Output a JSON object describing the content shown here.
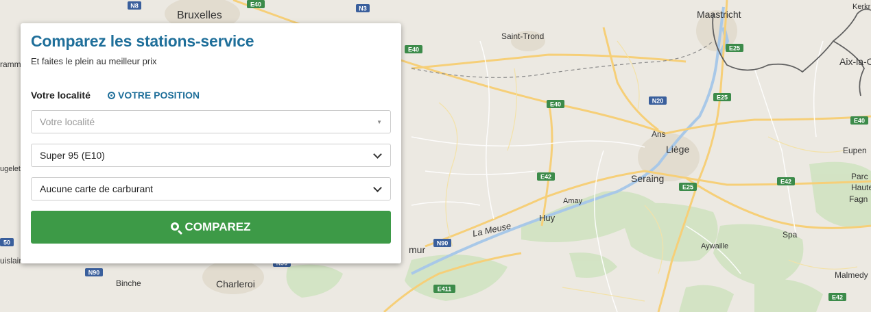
{
  "map": {
    "places": [
      {
        "name": "Bruxelles",
        "size": 16
      },
      {
        "name": "Maastricht",
        "size": 14
      },
      {
        "name": "Saint-Trond",
        "size": 12
      },
      {
        "name": "Kerkr",
        "size": 11
      },
      {
        "name": "Aix-la-C",
        "size": 14
      },
      {
        "name": "Ans",
        "size": 12
      },
      {
        "name": "Liège",
        "size": 14
      },
      {
        "name": "Eupen",
        "size": 12
      },
      {
        "name": "Seraing",
        "size": 14
      },
      {
        "name": "Amay",
        "size": 11
      },
      {
        "name": "Huy",
        "size": 13
      },
      {
        "name": "La Meuse",
        "size": 13
      },
      {
        "name": "Aywaille",
        "size": 11
      },
      {
        "name": "Spa",
        "size": 12
      },
      {
        "name": "Malmedy",
        "size": 12
      },
      {
        "name": "Binche",
        "size": 12
      },
      {
        "name": "Charleroi",
        "size": 14
      },
      {
        "name": "mur",
        "size": 14
      },
      {
        "name": "ramm",
        "size": 12
      },
      {
        "name": "ugelet",
        "size": 11
      },
      {
        "name": "uislair",
        "size": 12
      },
      {
        "name": "Parc",
        "size": 12
      },
      {
        "name": "Haute",
        "size": 12
      },
      {
        "name": "Fagn",
        "size": 12
      }
    ],
    "shields": [
      {
        "label": "E40",
        "color": "green"
      },
      {
        "label": "N3",
        "color": "blue"
      },
      {
        "label": "N8",
        "color": "blue"
      },
      {
        "label": "E40",
        "color": "green"
      },
      {
        "label": "E25",
        "color": "green"
      },
      {
        "label": "E40",
        "color": "green"
      },
      {
        "label": "N20",
        "color": "blue"
      },
      {
        "label": "E25",
        "color": "green"
      },
      {
        "label": "E40",
        "color": "green"
      },
      {
        "label": "E42",
        "color": "green"
      },
      {
        "label": "E25",
        "color": "green"
      },
      {
        "label": "E42",
        "color": "green"
      },
      {
        "label": "N90",
        "color": "blue"
      },
      {
        "label": "N90",
        "color": "blue"
      },
      {
        "label": "N90",
        "color": "blue"
      },
      {
        "label": "E411",
        "color": "green"
      },
      {
        "label": "E42",
        "color": "green"
      },
      {
        "label": "50",
        "color": "blue"
      }
    ]
  },
  "form": {
    "title": "Comparez les stations-service",
    "subtitle": "Et faites le plein au meilleur prix",
    "location_label": "Votre localité",
    "position_link": "VOTRE POSITION",
    "location_placeholder": "Votre localité",
    "fuel_value": "Super 95 (E10)",
    "card_value": "Aucune carte de carburant",
    "submit_label": "COMPAREZ"
  },
  "colors": {
    "title_blue": "#1f6f9a",
    "button_green": "#3d9a47",
    "map_background": "#ece9e2"
  }
}
